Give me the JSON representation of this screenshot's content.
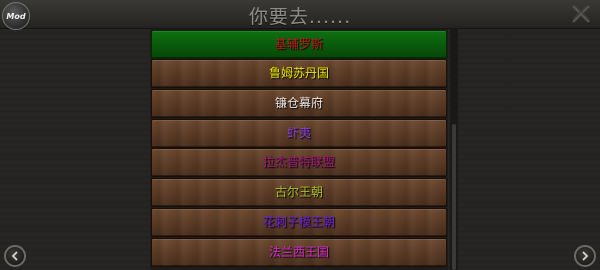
{
  "header": {
    "title": "你要去......",
    "mod_label": "Mod"
  },
  "destinations": [
    {
      "label": "基辅罗斯",
      "color": "#c01818",
      "selected": true
    },
    {
      "label": "鲁姆苏丹国",
      "color": "#e6e600",
      "selected": false
    },
    {
      "label": "镰仓幕府",
      "color": "#ece4e0",
      "selected": false
    },
    {
      "label": "虾夷",
      "color": "#8a3fd6",
      "selected": false
    },
    {
      "label": "拉杰普特联盟",
      "color": "#a0177a",
      "selected": false
    },
    {
      "label": "古尔王朝",
      "color": "#a8c022",
      "selected": false
    },
    {
      "label": "花剌子模王朝",
      "color": "#6a1fd8",
      "selected": false
    },
    {
      "label": "法兰西王国",
      "color": "#d62ad0",
      "selected": false
    }
  ],
  "icons": {
    "close": "close-icon",
    "prev": "arrow-left-icon",
    "next": "arrow-right-icon"
  },
  "colors": {
    "selected_row": "#0a5c0c",
    "row_wood": "#5d3d27"
  }
}
